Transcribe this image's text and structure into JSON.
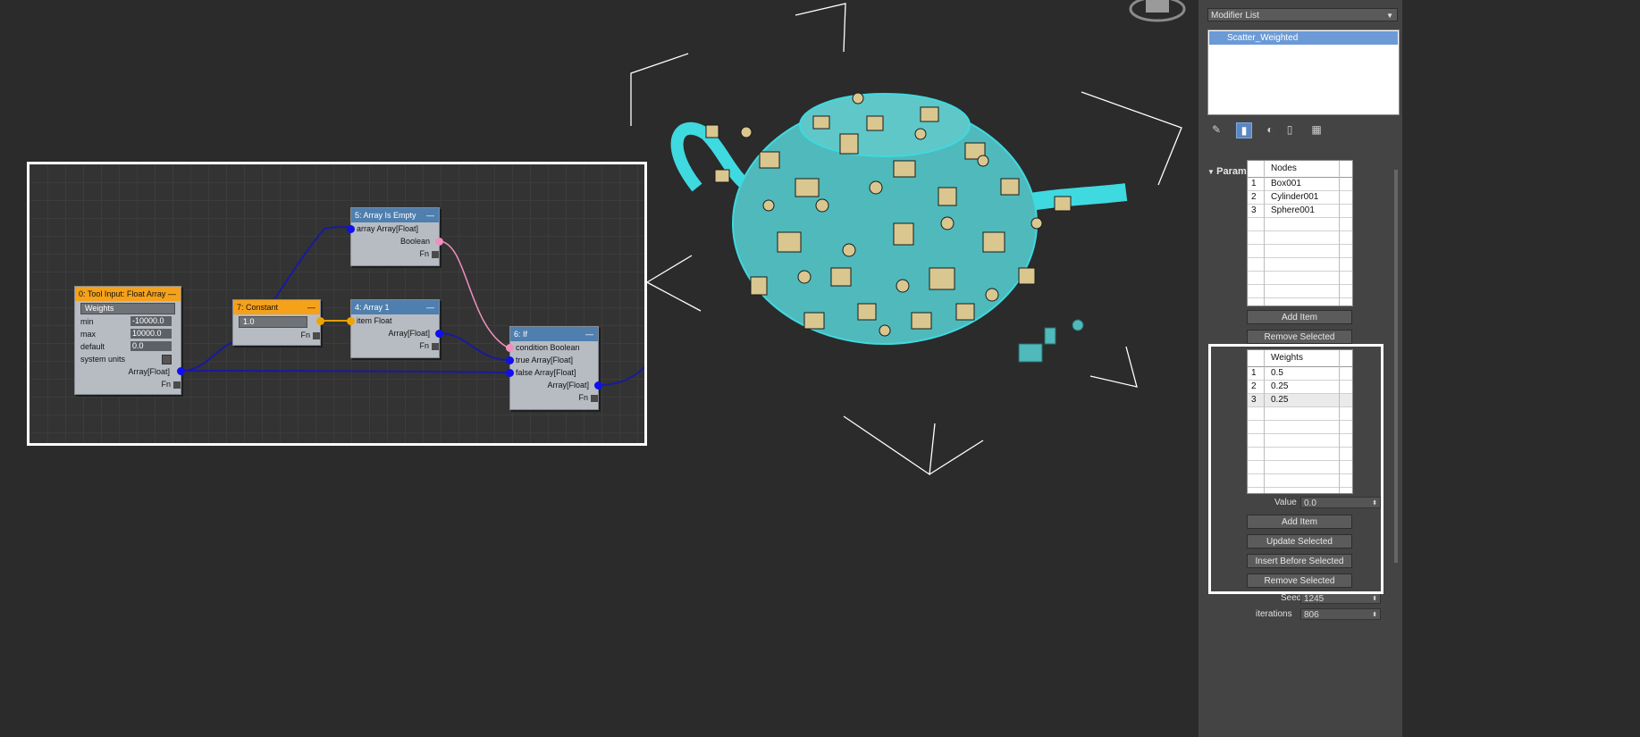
{
  "node_editor": {
    "nodes": {
      "tool_input": {
        "title": "0: Tool Input: Float Array",
        "name_field": "Weights",
        "min_label": "min",
        "min_value": "-10000.0",
        "max_label": "max",
        "max_value": "10000.0",
        "default_label": "default",
        "default_value": "0.0",
        "system_units_label": "system units",
        "output_label": "Array[Float]",
        "fn_label": "Fn"
      },
      "constant": {
        "title": "7: Constant",
        "value": "1.0",
        "fn_label": "Fn"
      },
      "array_is_empty": {
        "title": "5: Array Is Empty",
        "input_label": "array Array[Float]",
        "output_label": "Boolean",
        "fn_label": "Fn"
      },
      "array_1": {
        "title": "4: Array 1",
        "input_label": "item Float",
        "output_label": "Array[Float]",
        "fn_label": "Fn"
      },
      "if_node": {
        "title": "6: If",
        "condition_label": "condition Boolean",
        "true_label": "true Array[Float]",
        "false_label": "false Array[Float]",
        "output_label": "Array[Float]",
        "fn_label": "Fn"
      }
    },
    "minimize_glyph": "—"
  },
  "panel": {
    "modifier_list": "Modifier List",
    "stack_item": "Scatter_Weighted",
    "rollout_title": "Parameters",
    "nodes_list": {
      "header": "Nodes",
      "rows": [
        [
          "1",
          "Box001"
        ],
        [
          "2",
          "Cylinder001"
        ],
        [
          "3",
          "Sphere001"
        ]
      ]
    },
    "nodes_buttons": {
      "add": "Add Item",
      "remove": "Remove Selected"
    },
    "weights_list": {
      "header": "Weights",
      "rows": [
        [
          "1",
          "0.5"
        ],
        [
          "2",
          "0.25"
        ],
        [
          "3",
          "0.25"
        ]
      ]
    },
    "value_label": "Value",
    "value": "0.0",
    "weights_buttons": {
      "add": "Add Item",
      "update": "Update Selected",
      "insert": "Insert Before Selected",
      "remove": "Remove Selected"
    },
    "seed_label": "Seed",
    "seed_value": "1245",
    "iterations_label": "iterations",
    "iterations_value": "806"
  },
  "colors": {
    "header_orange": "#f5a11a",
    "header_blue": "#4f7fae",
    "selection_cyan": "#3fd9e0",
    "teapot": "#4fbfbf",
    "scatter_objects": "#d9c78f"
  },
  "icons": [
    "pin-icon",
    "show-end-result-icon",
    "make-unique-icon",
    "remove-modifier-icon",
    "configure-modifier-sets-icon",
    "viewcube-icon"
  ]
}
